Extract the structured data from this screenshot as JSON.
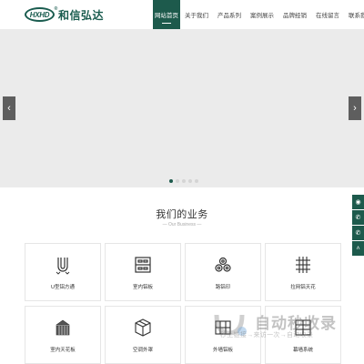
{
  "header": {
    "logo_mark": "HXHD",
    "logo_reg": "®",
    "logo_text": "和信弘达",
    "nav": [
      {
        "label": "网站首页",
        "active": true
      },
      {
        "label": "关于我们"
      },
      {
        "label": "产品系列"
      },
      {
        "label": "案例展示"
      },
      {
        "label": "品牌经销"
      },
      {
        "label": "在线留言"
      },
      {
        "label": "联系我们"
      }
    ]
  },
  "banner": {
    "prev_icon": "chevron-left",
    "next_icon": "chevron-right",
    "dots_total": 5,
    "active_dot": 1
  },
  "business": {
    "title": "我们的业务",
    "subtitle": "— Our Business —",
    "items": [
      {
        "label": "U型铝方通",
        "icon": "u-channel-icon"
      },
      {
        "label": "室内铝板",
        "icon": "panel-icon"
      },
      {
        "label": "路铝印",
        "icon": "pipes-icon"
      },
      {
        "label": "拉网铝天花",
        "icon": "mesh-icon"
      },
      {
        "label": "室内天花板",
        "icon": "ceiling-icon"
      },
      {
        "label": "空调外罩",
        "icon": "box-icon"
      },
      {
        "label": "外墙铝板",
        "icon": "wall-panel-icon"
      },
      {
        "label": "幕墙系统",
        "icon": "curtain-wall-icon"
      }
    ]
  },
  "side_bar": [
    "chat-icon",
    "phone-icon",
    "phone-icon",
    "top-icon"
  ],
  "watermark": {
    "title": "自动秒收录",
    "subtitle": "秒上链接→来访一次→自动收录"
  },
  "colors": {
    "brand": "#1d5a4c",
    "banner_bg": "#ebebeb"
  }
}
